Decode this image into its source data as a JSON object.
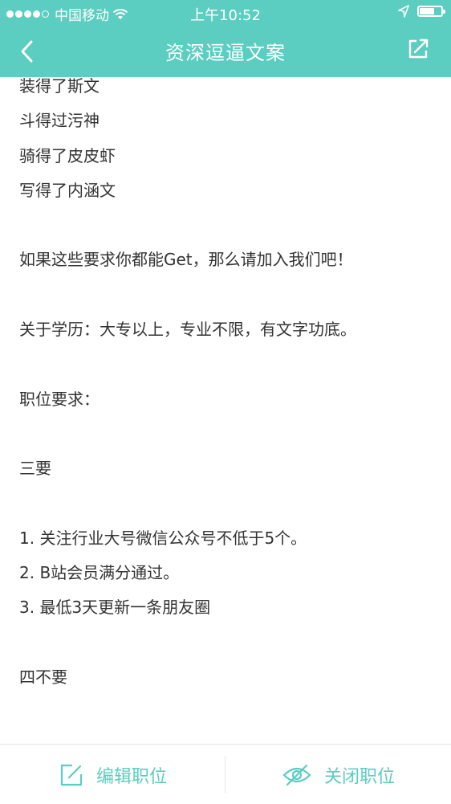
{
  "status_bar": {
    "carrier": "中国移动",
    "time": "上午10:52",
    "battery_level": 0.7
  },
  "nav": {
    "title": "资深逗逼文案",
    "back_icon": "chevron-left-icon",
    "share_icon": "share-icon"
  },
  "content": {
    "lines": [
      "装得了斯文",
      "斗得过污神",
      "骑得了皮皮虾",
      "写得了内涵文",
      "",
      "如果这些要求你都能Get，那么请加入我们吧！",
      "",
      "关于学历：大专以上，专业不限，有文字功底。",
      "",
      "职位要求：",
      "",
      "三要",
      "",
      "1. 关注行业大号微信公众号不低于5个。",
      "2. B站会员满分通过。",
      "3. 最低3天更新一条朋友圈",
      "",
      "四不要"
    ]
  },
  "bottom_bar": {
    "edit_label": "编辑职位",
    "close_label": "关闭职位"
  },
  "colors": {
    "accent": "#5ccdc1",
    "text": "#333333"
  }
}
